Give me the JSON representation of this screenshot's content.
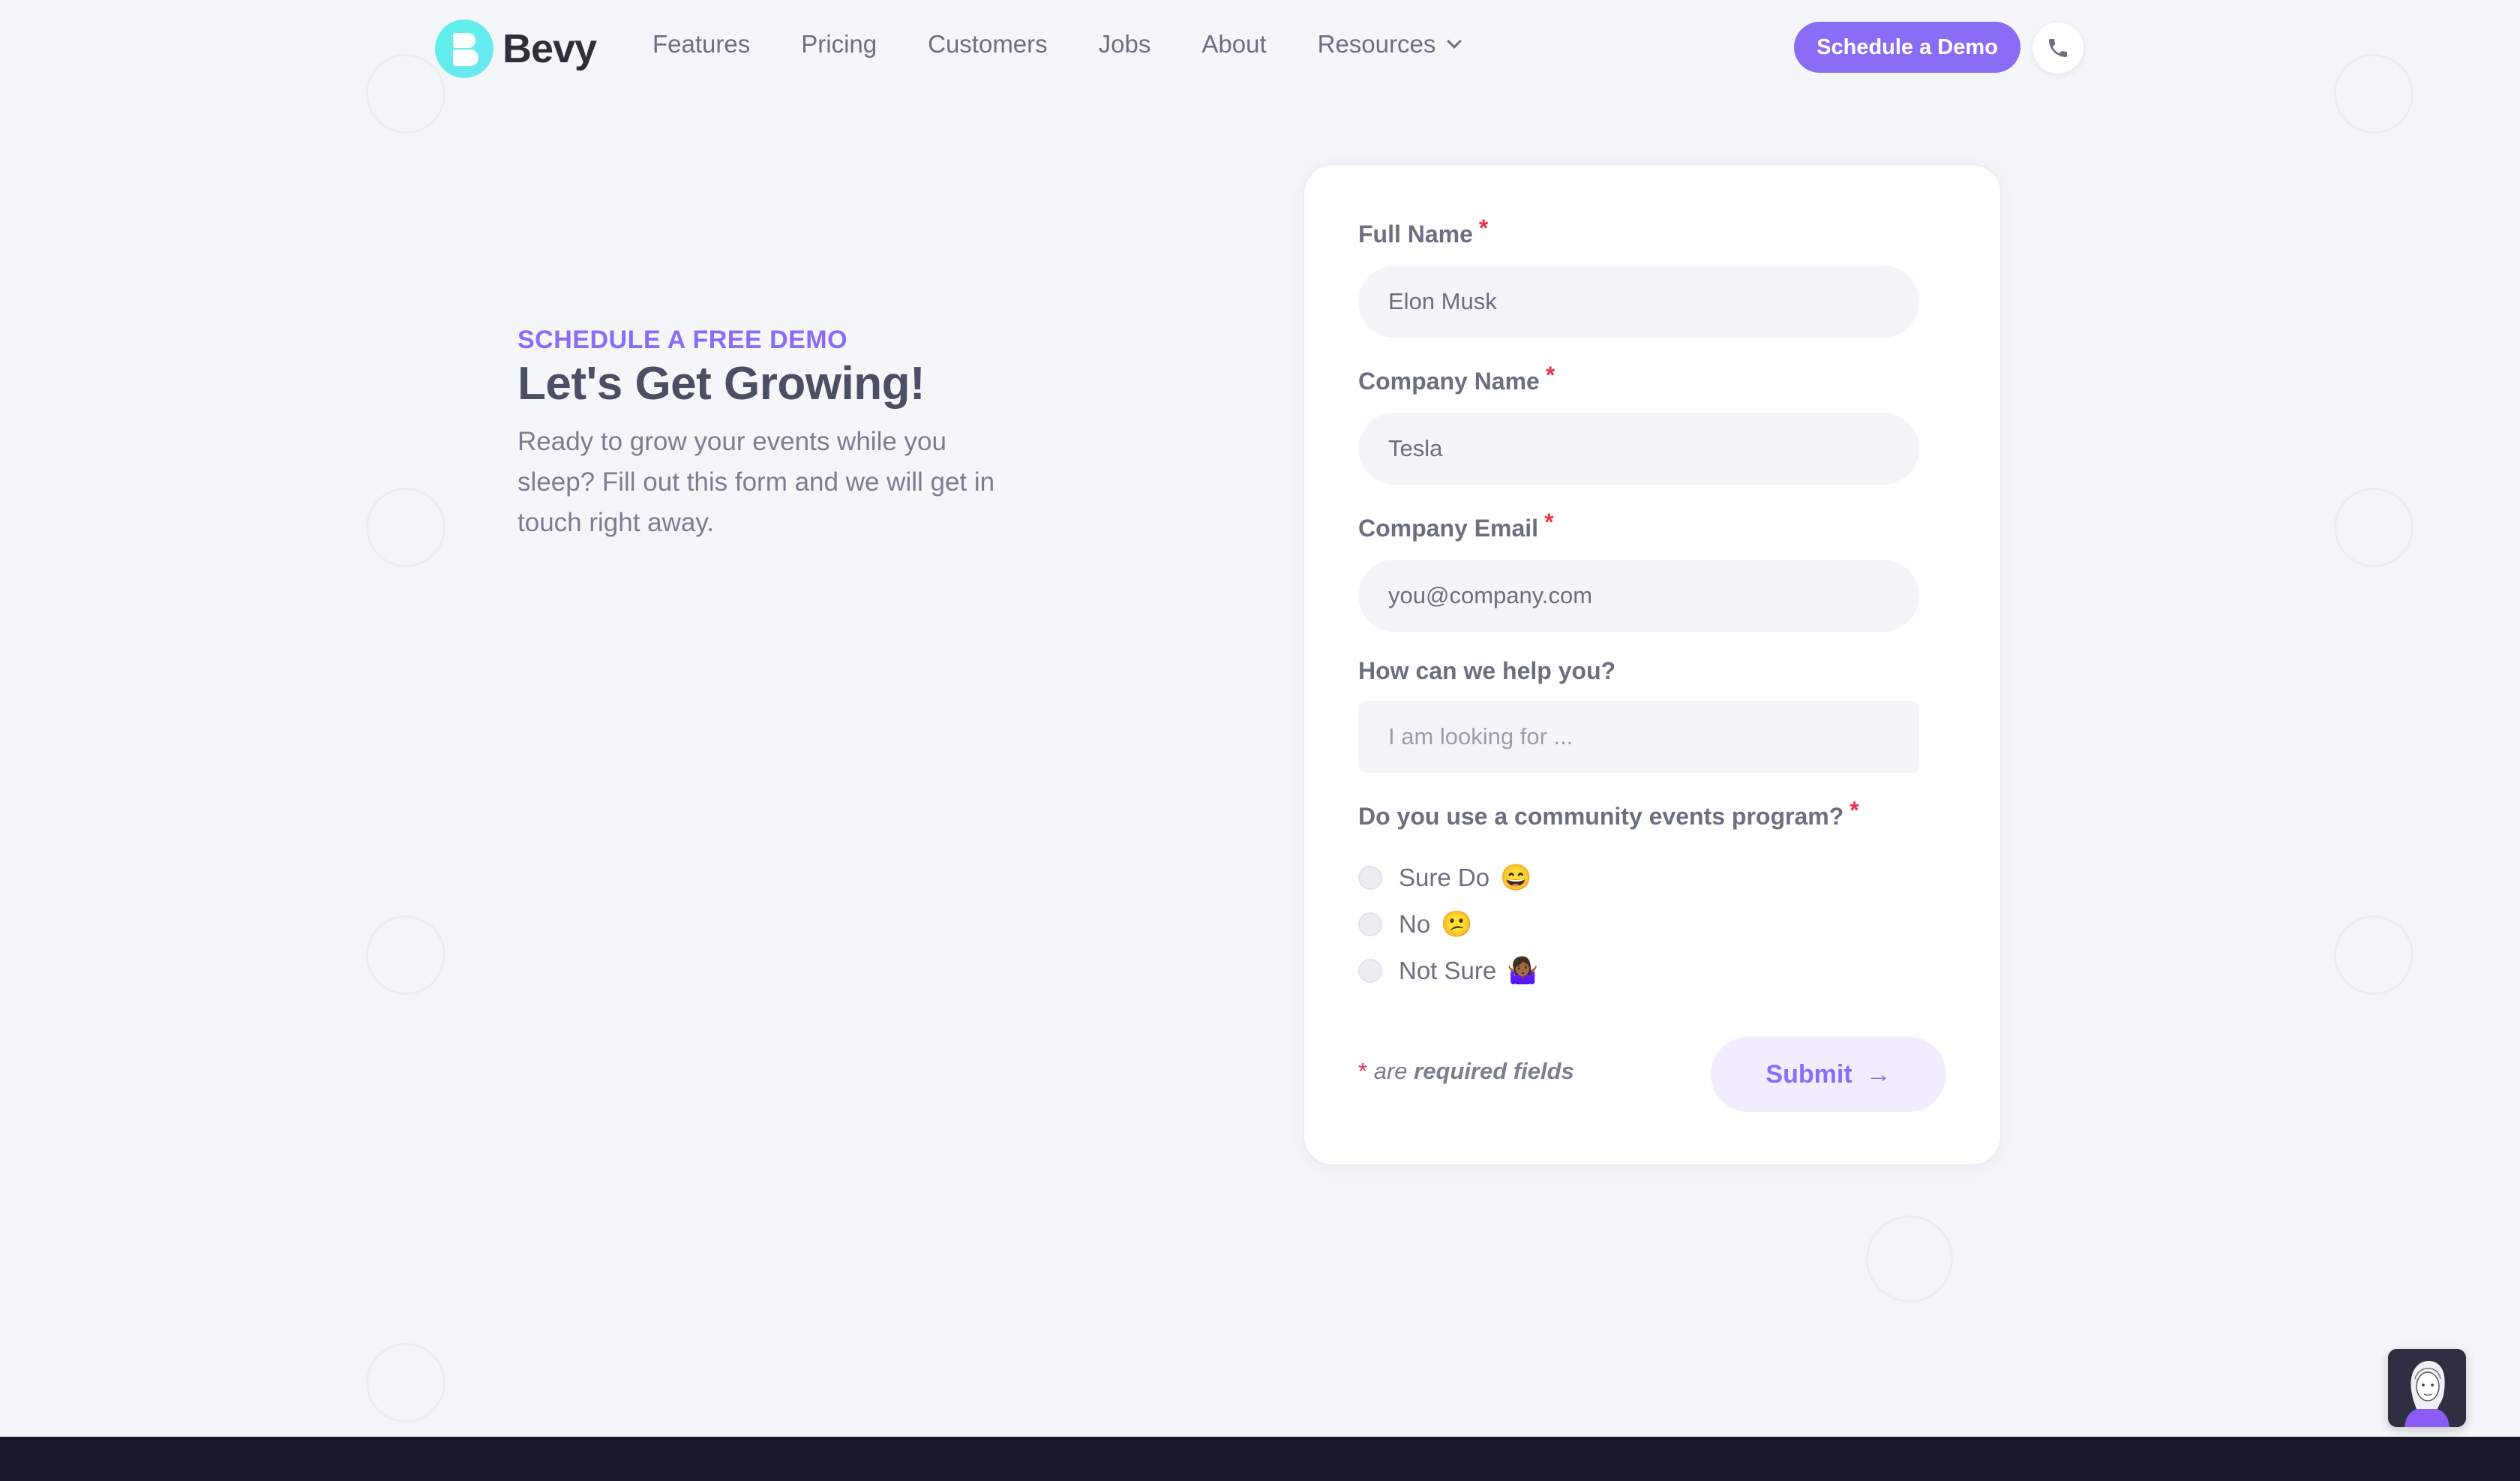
{
  "nav": {
    "brand": "Bevy",
    "links": [
      "Features",
      "Pricing",
      "Customers",
      "Jobs",
      "About"
    ],
    "resources_label": "Resources",
    "cta_label": "Schedule a Demo",
    "phone_icon": "phone-icon"
  },
  "hero": {
    "eyebrow": "SCHEDULE A FREE DEMO",
    "headline": "Let's Get Growing!",
    "subtext": "Ready to grow your events while you sleep? Fill out this form and we will get in touch right away."
  },
  "form": {
    "full_name": {
      "label": "Full Name",
      "required": "*",
      "value": "Elon Musk"
    },
    "company_name": {
      "label": "Company Name",
      "required": "*",
      "value": "Tesla"
    },
    "company_email": {
      "label": "Company Email",
      "required": "*",
      "value": "you@company.com"
    },
    "help": {
      "label": "How can we help you?",
      "placeholder": "I am looking for ..."
    },
    "community": {
      "label": "Do you use a community events program?",
      "required": "*",
      "options": [
        {
          "label": "Sure Do",
          "emoji": "😄"
        },
        {
          "label": "No",
          "emoji": "😕"
        },
        {
          "label": "Not Sure",
          "emoji": "🤷🏾‍♀️"
        }
      ]
    },
    "required_note": {
      "star": "*",
      "are": "are",
      "fields": "required fields"
    },
    "submit_label": "Submit",
    "submit_arrow": "→"
  },
  "colors": {
    "accent": "#8b6cf6",
    "required": "#e8344e",
    "logo": "#5ff0e9",
    "footer": "#161826"
  }
}
